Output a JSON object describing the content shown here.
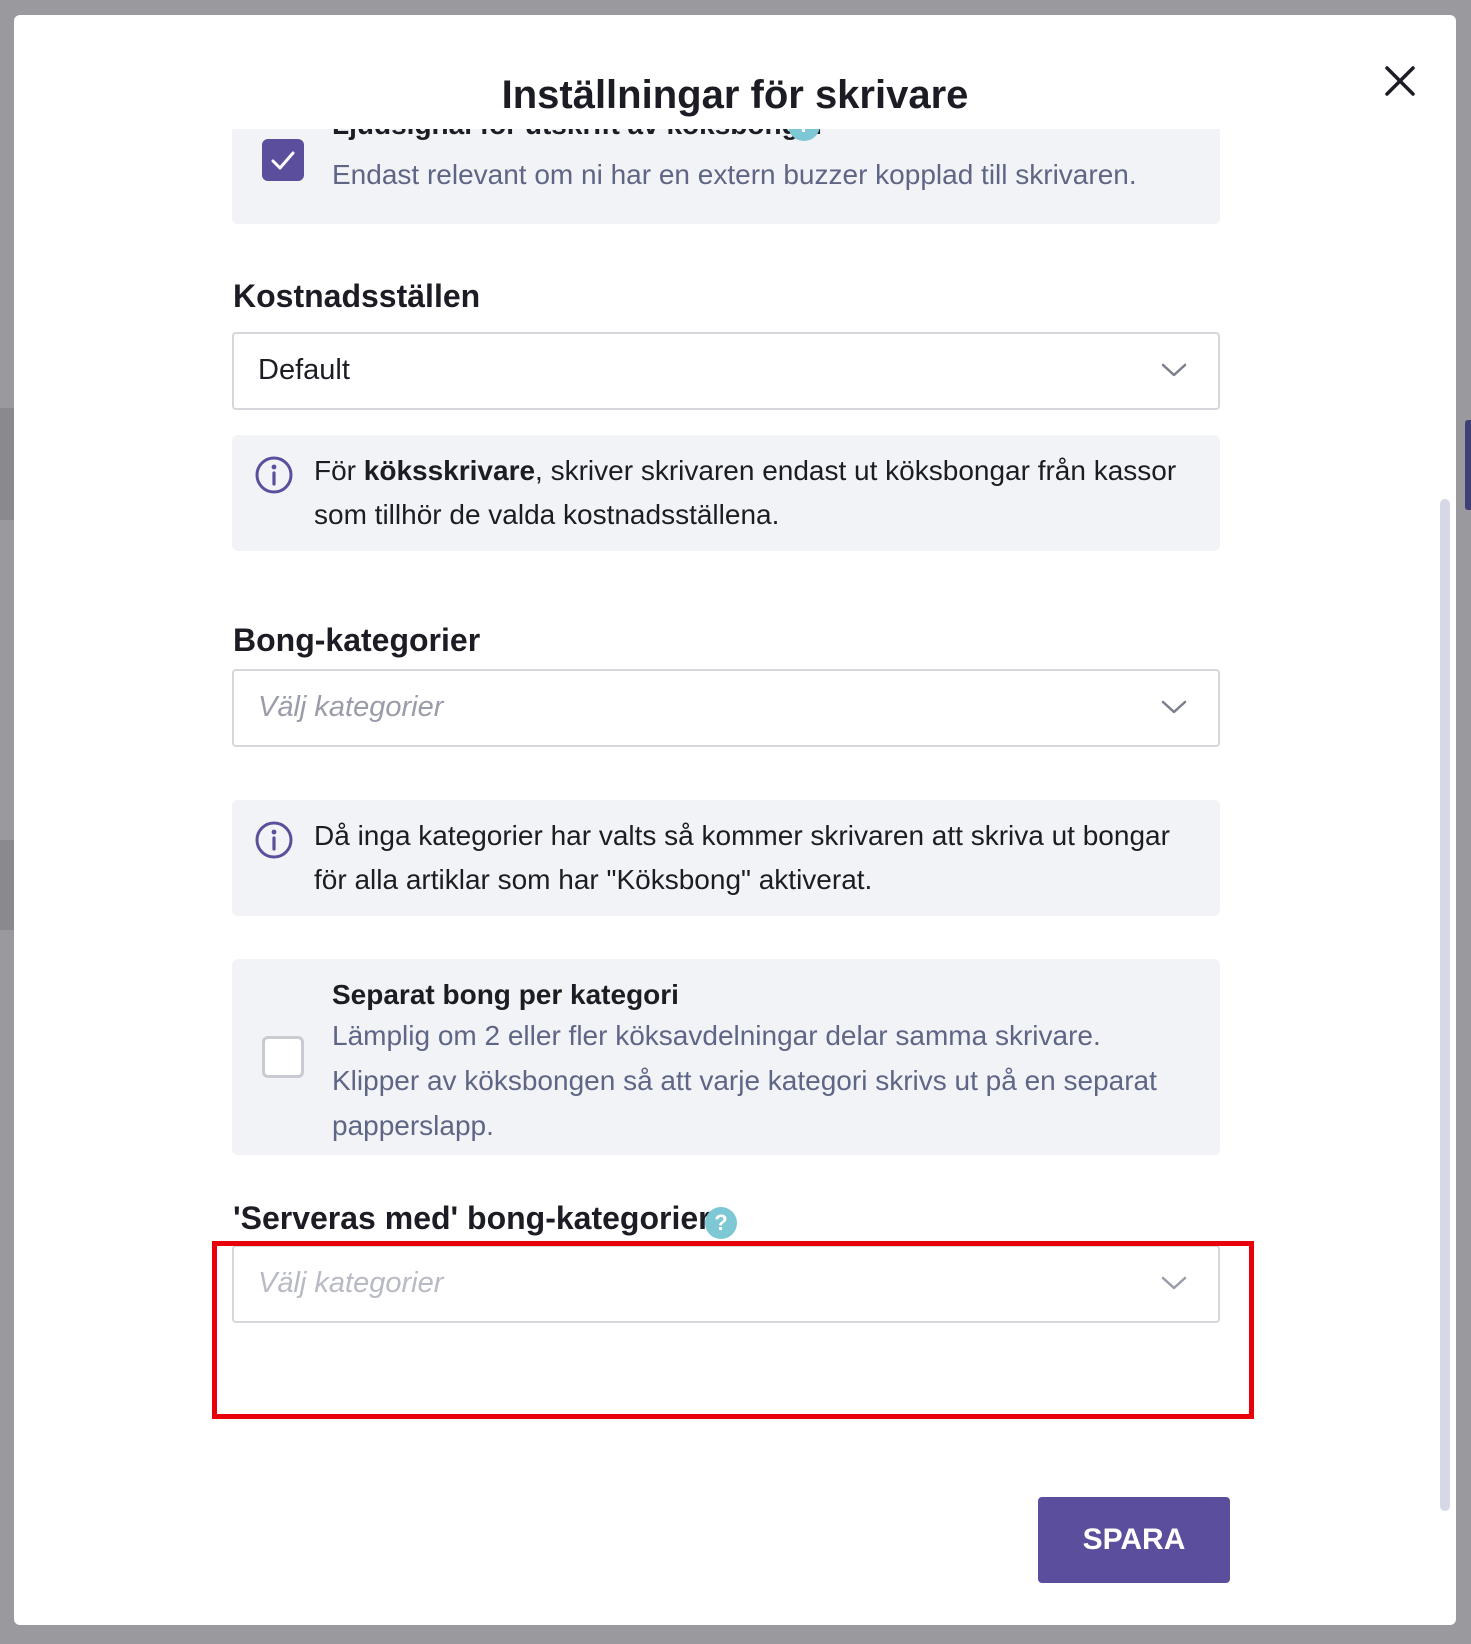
{
  "modal": {
    "title": "Inställningar för skrivare",
    "save_label": "SPARA"
  },
  "buzzer": {
    "title": "Ljudsignal för utskrift av köksbongar",
    "description": "Endast relevant om ni har en extern buzzer kopplad till skrivaren.",
    "checked": true
  },
  "cost_centers": {
    "label": "Kostnadsställen",
    "selected": "Default",
    "info_prefix": "För ",
    "info_bold": "köksskrivare",
    "info_suffix": ", skriver skrivaren endast ut köksbongar från kassor som tillhör de valda kostnadsställena."
  },
  "categories": {
    "label": "Bong-kategorier",
    "placeholder": "Välj kategorier",
    "info": "Då inga kategorier har valts så kommer skrivaren att skriva ut bongar för alla artiklar som har \"Köksbong\" aktiverat."
  },
  "separate": {
    "title": "Separat bong per kategori",
    "description": "Lämplig om 2 eller fler köksavdelningar delar samma skrivare. Klipper av köksbongen så att varje kategori skrivs ut på en separat papperslapp.",
    "checked": false
  },
  "served_with": {
    "label": "'Serveras med' bong-kategorier",
    "placeholder": "Välj kategorier"
  },
  "icons": {
    "close": "close-icon",
    "check": "check-icon",
    "help": "help-icon",
    "info": "info-icon",
    "chevron": "chevron-down-icon",
    "help_glyph": "?"
  },
  "colors": {
    "accent": "#5b4f9d",
    "help": "#7ec8d6",
    "highlight": "#e8000b",
    "card_bg": "#f2f3f6"
  }
}
